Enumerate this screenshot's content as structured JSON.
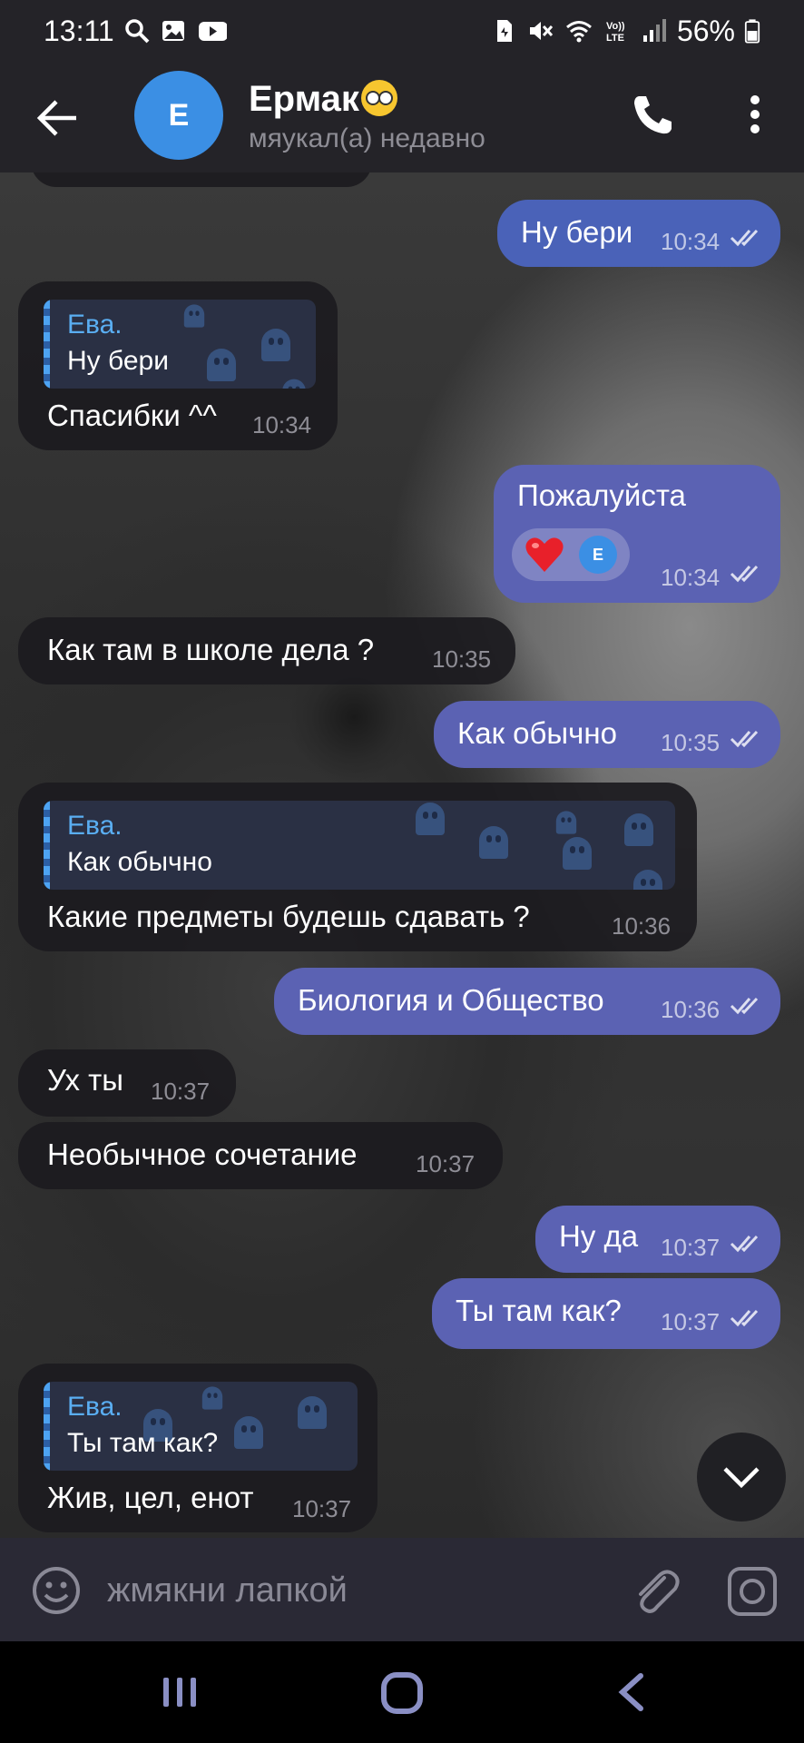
{
  "status_bar": {
    "time": "13:11",
    "battery": "56%",
    "icons_left": [
      "search-icon",
      "gallery-icon",
      "youtube-icon"
    ],
    "icons_right": [
      "sim-icon",
      "mute-icon",
      "wifi-icon",
      "volte-icon",
      "signal-icon",
      "battery-icon"
    ]
  },
  "header": {
    "contact_name": "Ермак",
    "contact_emoji": "🙄",
    "status": "мяукал(а) недавно",
    "avatar_letter": "E"
  },
  "messages": [
    {
      "dir": "out",
      "text": "Ну бери",
      "time": "10:34",
      "read": true
    },
    {
      "dir": "in",
      "reply": {
        "name": "Ева.",
        "text": "Ну бери"
      },
      "text": "Спасибки ^^",
      "time": "10:34"
    },
    {
      "dir": "out",
      "text": "Пожалуйста",
      "time": "10:34",
      "read": true,
      "reaction": {
        "emoji": "heart",
        "avatar_letter": "E"
      }
    },
    {
      "dir": "in",
      "text": "Как там в школе дела ?",
      "time": "10:35"
    },
    {
      "dir": "out",
      "text": "Как обычно",
      "time": "10:35",
      "read": true
    },
    {
      "dir": "in",
      "reply": {
        "name": "Ева.",
        "text": "Как обычно"
      },
      "text": "Какие предметы будешь сдавать ?",
      "time": "10:36"
    },
    {
      "dir": "out",
      "text": "Биология и Общество",
      "time": "10:36",
      "read": true
    },
    {
      "dir": "in",
      "text": "Ух ты",
      "time": "10:37"
    },
    {
      "dir": "in",
      "text": "Необычное сочетание",
      "time": "10:37"
    },
    {
      "dir": "out",
      "text": "Ну да",
      "time": "10:37",
      "read": true
    },
    {
      "dir": "out",
      "text": "Ты там как?",
      "time": "10:37",
      "read": true
    },
    {
      "dir": "in",
      "reply": {
        "name": "Ева.",
        "text": "Ты там как?"
      },
      "text": "Жив, цел, енот",
      "time": "10:37"
    }
  ],
  "input": {
    "placeholder": "жмякни лапкой"
  },
  "colors": {
    "header_bg": "#242328",
    "incoming_bubble": "#1c1b1f",
    "outgoing_bubble": "#4a62b8",
    "reply_name": "#5aaef2",
    "avatar": "#3b8fe4"
  }
}
